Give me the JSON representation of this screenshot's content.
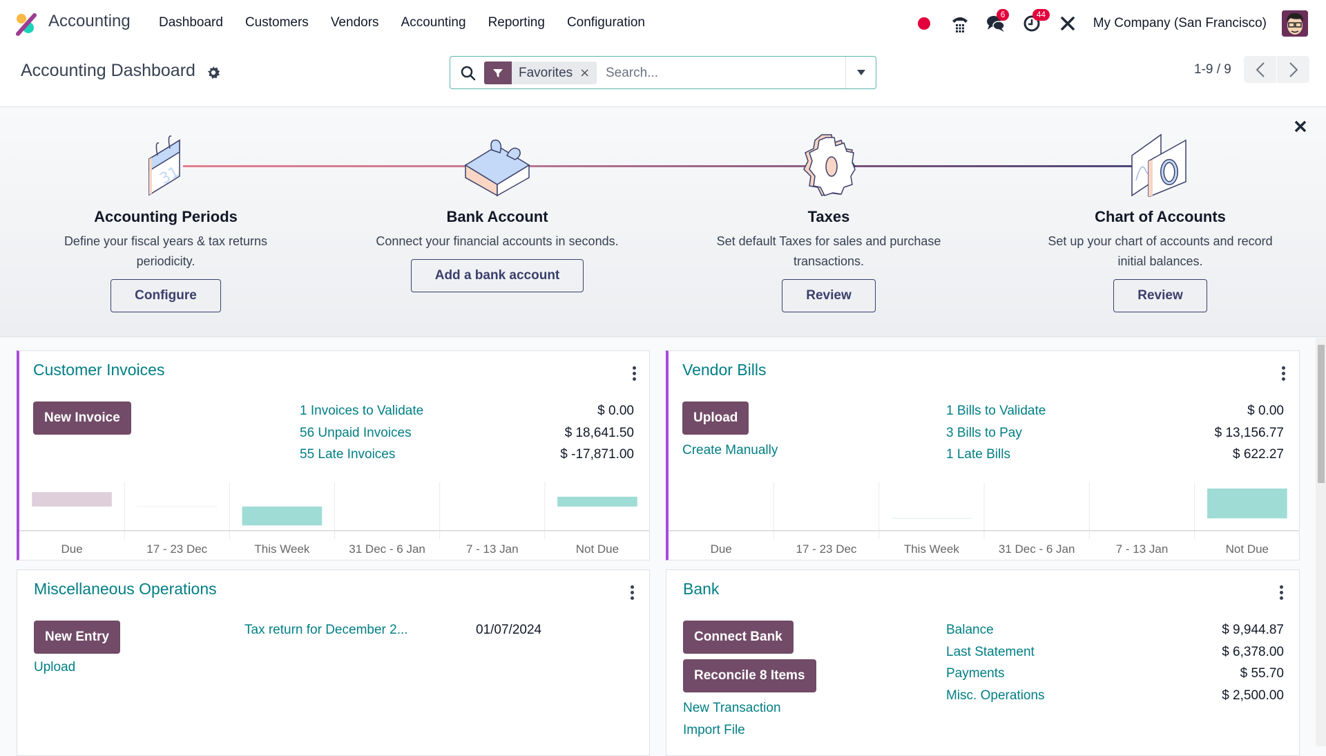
{
  "app": {
    "name": "Accounting",
    "nav": [
      "Dashboard",
      "Customers",
      "Vendors",
      "Accounting",
      "Reporting",
      "Configuration"
    ],
    "icons": {
      "logo": "odoo-accounting-logo",
      "status": "status-dot-icon",
      "phone": "phone-icon",
      "messages": "chat-icon",
      "activities": "clock-icon",
      "debug": "tools-icon"
    },
    "badges": {
      "messages": "6",
      "activities": "44"
    },
    "company": "My Company (San Francisco)",
    "colors": {
      "brand": "#714b67",
      "link": "#017e84",
      "badge": "#e1003b",
      "accent_border": "#a94bdb",
      "chart_positive": "#9fdcd6",
      "chart_past": "#decfdb"
    }
  },
  "control_panel": {
    "title": "Accounting Dashboard",
    "search": {
      "facet_label": "Favorites",
      "placeholder": "Search..."
    },
    "pager": {
      "value": "1-9 / 9"
    }
  },
  "onboarding": {
    "steps": [
      {
        "title": "Accounting Periods",
        "description": "Define your fiscal years & tax returns periodicity.",
        "button": "Configure",
        "icon": "calendar-icon"
      },
      {
        "title": "Bank Account",
        "description": "Connect your financial accounts in seconds.",
        "button": "Add a bank account",
        "icon": "puzzle-icon"
      },
      {
        "title": "Taxes",
        "description": "Set default Taxes for sales and purchase transactions.",
        "button": "Review",
        "icon": "gear-icon"
      },
      {
        "title": "Chart of Accounts",
        "description": "Set up your chart of accounts and record initial balances.",
        "button": "Review",
        "icon": "charts-icon"
      }
    ]
  },
  "cards": {
    "customer_invoices": {
      "title": "Customer Invoices",
      "primary_button": "New Invoice",
      "rows": [
        {
          "label": "1 Invoices to Validate",
          "amount": "$ 0.00"
        },
        {
          "label": "56 Unpaid Invoices",
          "amount": "$ 18,641.50"
        },
        {
          "label": "55 Late Invoices",
          "amount": "$ -17,871.00"
        }
      ]
    },
    "vendor_bills": {
      "title": "Vendor Bills",
      "primary_button": "Upload",
      "secondary_link": "Create Manually",
      "rows": [
        {
          "label": "1 Bills to Validate",
          "amount": "$ 0.00"
        },
        {
          "label": "3 Bills to Pay",
          "amount": "$ 13,156.77"
        },
        {
          "label": "1 Late Bills",
          "amount": "$ 622.27"
        }
      ]
    },
    "misc_operations": {
      "title": "Miscellaneous Operations",
      "primary_button": "New Entry",
      "secondary_link": "Upload",
      "entries": [
        {
          "label": "Tax return for December 2...",
          "date": "01/07/2024"
        }
      ]
    },
    "bank": {
      "title": "Bank",
      "buttons": [
        "Connect Bank",
        "Reconcile 8 Items"
      ],
      "links": [
        "New Transaction",
        "Import File"
      ],
      "rows": [
        {
          "label": "Balance",
          "amount": "$ 9,944.87"
        },
        {
          "label": "Last Statement",
          "amount": "$ 6,378.00"
        },
        {
          "label": "Payments",
          "amount": "$ 55.70"
        },
        {
          "label": "Misc. Operations",
          "amount": "$ 2,500.00"
        }
      ]
    }
  },
  "chart_data": [
    {
      "type": "bar",
      "title": "Customer Invoices",
      "categories": [
        "Due",
        "17 - 23 Dec",
        "This Week",
        "31 Dec - 6 Jan",
        "7 - 13 Jan",
        "Not Due"
      ],
      "values": [
        19,
        0.3,
        -25,
        0,
        0,
        13
      ],
      "value_units": "relative (no axis shown)",
      "bar_types": [
        "past",
        "past",
        "future",
        "future",
        "future",
        "future"
      ],
      "xlabel": "",
      "ylabel": "",
      "grid": true,
      "ylim": [
        -32,
        32
      ]
    },
    {
      "type": "bar",
      "title": "Vendor Bills",
      "categories": [
        "Due",
        "17 - 23 Dec",
        "This Week",
        "31 Dec - 6 Jan",
        "7 - 13 Jan",
        "Not Due"
      ],
      "values": [
        0,
        0,
        0.3,
        0,
        0,
        29
      ],
      "value_units": "relative (no axis shown)",
      "bar_types": [
        "past",
        "past",
        "future",
        "future",
        "future",
        "future"
      ],
      "xlabel": "",
      "ylabel": "",
      "grid": true,
      "ylim": [
        -12,
        35
      ]
    }
  ]
}
